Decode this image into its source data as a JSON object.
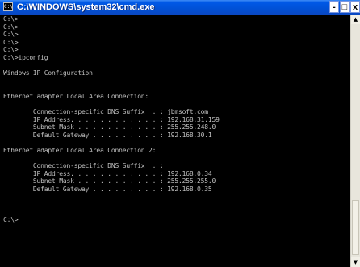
{
  "window": {
    "title": "C:\\WINDOWS\\system32\\cmd.exe",
    "icon_label": "C:\\",
    "minimize_label": "-",
    "maximize_label": "□",
    "close_label": "x"
  },
  "console": {
    "lines": [
      "C:\\>",
      "C:\\>",
      "C:\\>",
      "C:\\>",
      "C:\\>",
      "C:\\>ipconfig",
      "",
      "Windows IP Configuration",
      "",
      "",
      "Ethernet adapter Local Area Connection:",
      "",
      "        Connection-specific DNS Suffix  . : jbmsoft.com",
      "        IP Address. . . . . . . . . . . . : 192.168.31.159",
      "        Subnet Mask . . . . . . . . . . . : 255.255.248.0",
      "        Default Gateway . . . . . . . . . : 192.168.30.1",
      "",
      "Ethernet adapter Local Area Connection 2:",
      "",
      "        Connection-specific DNS Suffix  . :",
      "        IP Address. . . . . . . . . . . . : 192.168.0.34",
      "        Subnet Mask . . . . . . . . . . . : 255.255.255.0",
      "        Default Gateway . . . . . . . . . : 192.168.0.35",
      "",
      "",
      "",
      "C:\\>"
    ]
  },
  "scrollbar": {
    "up_arrow": "▲",
    "down_arrow": "▼"
  },
  "colors": {
    "titlebar": "#0058e6",
    "console_background": "#000000",
    "console_text": "#c0c0c0"
  },
  "icons": {
    "window_icon": "cmd-icon",
    "scroll_up": "arrow-up-icon",
    "scroll_down": "arrow-down-icon"
  }
}
